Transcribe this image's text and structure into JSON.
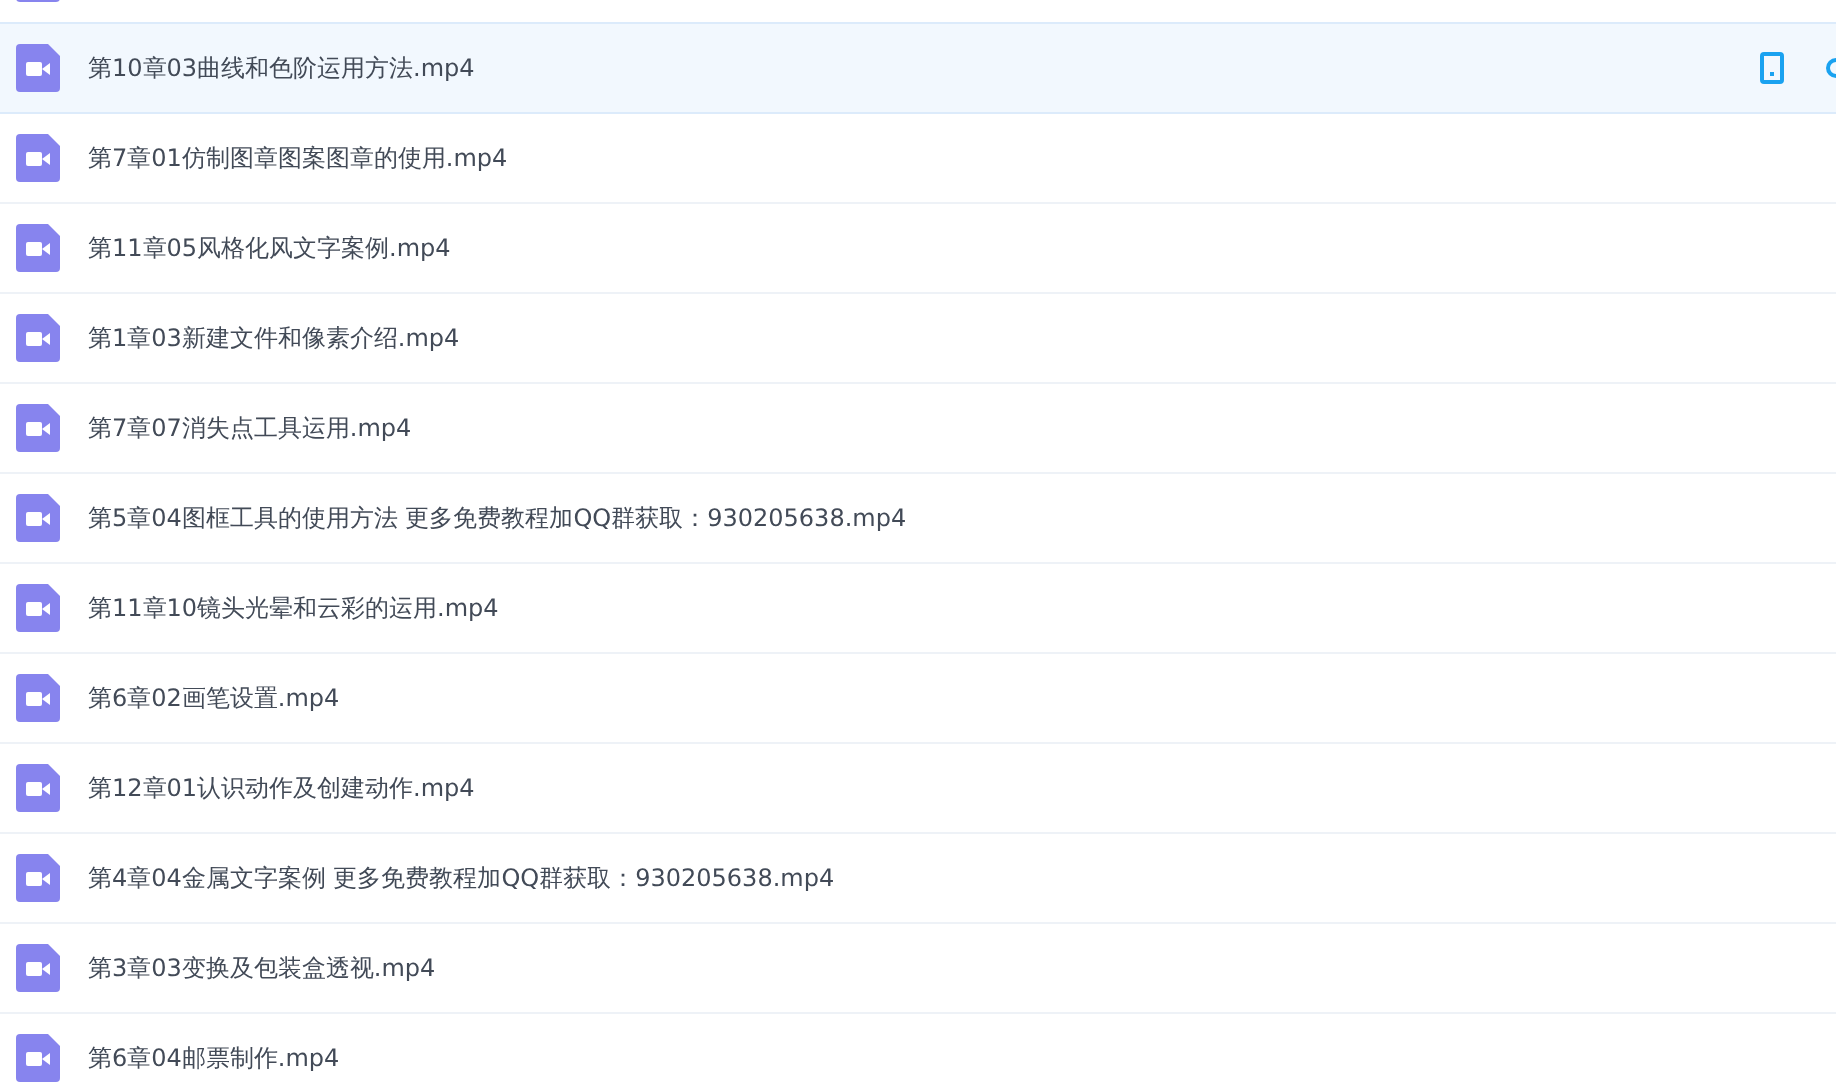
{
  "files": [
    {
      "kind": "cut"
    },
    {
      "name": "第10章03曲线和色阶运用方法.mp4",
      "selected": true
    },
    {
      "name": "第7章01仿制图章图案图章的使用.mp4",
      "selected": false
    },
    {
      "name": "第11章05风格化风文字案例.mp4",
      "selected": false
    },
    {
      "name": "第1章03新建文件和像素介绍.mp4",
      "selected": false
    },
    {
      "name": "第7章07消失点工具运用.mp4",
      "selected": false
    },
    {
      "name": "第5章04图框工具的使用方法 更多免费教程加QQ群获取：930205638.mp4",
      "selected": false
    },
    {
      "name": "第11章10镜头光晕和云彩的运用.mp4",
      "selected": false
    },
    {
      "name": "第6章02画笔设置.mp4",
      "selected": false
    },
    {
      "name": "第12章01认识动作及创建动作.mp4",
      "selected": false
    },
    {
      "name": "第4章04金属文字案例 更多免费教程加QQ群获取：930205638.mp4",
      "selected": false
    },
    {
      "name": "第3章03变换及包装盒透视.mp4",
      "selected": false
    },
    {
      "name": "第6章04邮票制作.mp4",
      "selected": false
    }
  ]
}
